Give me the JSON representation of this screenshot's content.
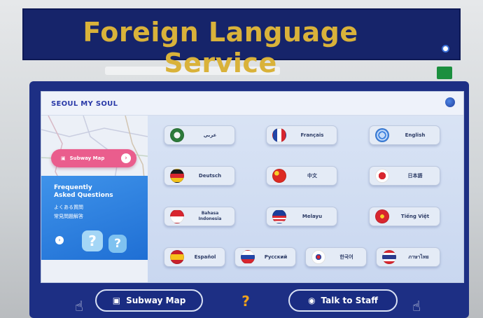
{
  "sign": {
    "title": "Foreign Language Service"
  },
  "screen": {
    "brand": "SEOUL MY SOUL",
    "left_panel": {
      "subway_pill_label": "Subway Map",
      "faq_title_line1": "Frequently",
      "faq_title_line2": "Asked Questions",
      "faq_jp": "よくある質問",
      "faq_zh": "常見問題解答",
      "q_mark": "?"
    },
    "languages": [
      {
        "label": "عربي",
        "icon": "flag-arabic-icon"
      },
      {
        "label": "Français",
        "icon": "flag-france-icon"
      },
      {
        "label": "English",
        "icon": "globe-icon"
      },
      {
        "label": "Deutsch",
        "icon": "flag-germany-icon"
      },
      {
        "label": "中文",
        "icon": "flag-china-icon"
      },
      {
        "label": "日本語",
        "icon": "flag-japan-icon"
      },
      {
        "label": "Bahasa Indonesia",
        "icon": "flag-indonesia-icon"
      },
      {
        "label": "Melayu",
        "icon": "flag-malaysia-icon"
      },
      {
        "label": "Tiếng Việt",
        "icon": "flag-vietnam-icon"
      },
      {
        "label": "Español",
        "icon": "flag-spain-icon"
      },
      {
        "label": "Русский",
        "icon": "flag-russia-icon"
      },
      {
        "label": "한국어",
        "icon": "flag-korea-icon"
      },
      {
        "label": "ภาษาไทย",
        "icon": "flag-thailand-icon"
      }
    ]
  },
  "bottom_bar": {
    "subway_map_label": "Subway Map",
    "help_label": "?",
    "talk_to_staff_label": "Talk to Staff"
  },
  "colors": {
    "sign_bg": "#16246a",
    "sign_text": "#d9b23a",
    "kiosk_frame": "#1d2f84",
    "subway_pill": "#ea5d8d",
    "faq_panel": "#1f6fd4"
  }
}
